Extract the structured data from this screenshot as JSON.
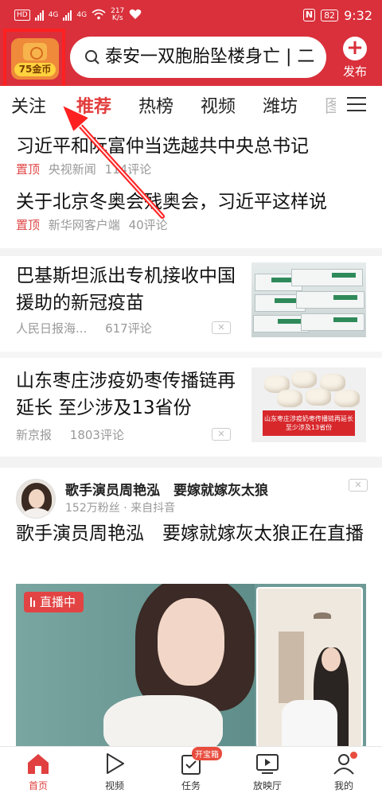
{
  "status_bar": {
    "hd_label": "HD",
    "net_speed_value": "217",
    "net_speed_unit": "K/s",
    "signal_1": "4G",
    "signal_2": "4G",
    "nfc_label": "N",
    "battery": "82",
    "time": "9:32"
  },
  "header": {
    "coin_label": "75金币",
    "search_text": "泰安一双胞胎坠楼身亡 | 二",
    "publish_label": "发布"
  },
  "tabs": [
    "关注",
    "推荐",
    "热榜",
    "视频",
    "潍坊",
    "图"
  ],
  "active_tab": "推荐",
  "pinned": [
    {
      "title": "习近平和阮富仲当选越共中央总书记",
      "tag": "置顶",
      "source": "央视新闻",
      "comments": "114评论"
    },
    {
      "title": "关于北京冬奥会残奥会，习近平这样说",
      "tag": "置顶",
      "source": "新华网客户端",
      "comments": "40评论"
    }
  ],
  "articles": [
    {
      "title": "巴基斯坦派出专机接收中国援助的新冠疫苗",
      "source": "人民日报海...",
      "comments": "617评论"
    },
    {
      "title": "山东枣庄涉疫奶枣传播链再延长 至少涉及13省份",
      "source": "新京报",
      "comments": "1803评论",
      "thumb_banner": "山东枣庄涉疫奶枣传播链再延长 至少涉及13省份"
    }
  ],
  "live_card": {
    "author": "歌手演员周艳泓　要嫁就嫁灰太狼",
    "followers": "152万粉丝",
    "source": "来自抖音",
    "title": "歌手演员周艳泓　要嫁就嫁灰太狼正在直播",
    "badge": "直播中"
  },
  "bottom_nav": [
    {
      "label": "首页",
      "icon": "home-icon",
      "active": true
    },
    {
      "label": "视频",
      "icon": "play-icon",
      "active": false
    },
    {
      "label": "任务",
      "icon": "task-icon",
      "active": false,
      "badge": "开宝箱"
    },
    {
      "label": "放映厅",
      "icon": "screen-icon",
      "active": false
    },
    {
      "label": "我的",
      "icon": "profile-icon",
      "active": false,
      "dot": true
    }
  ],
  "colors": {
    "brand_red": "#d9303b",
    "active_tab": "#e23b3b",
    "pin_tag": "#e04848",
    "highlight": "#ff2020"
  }
}
